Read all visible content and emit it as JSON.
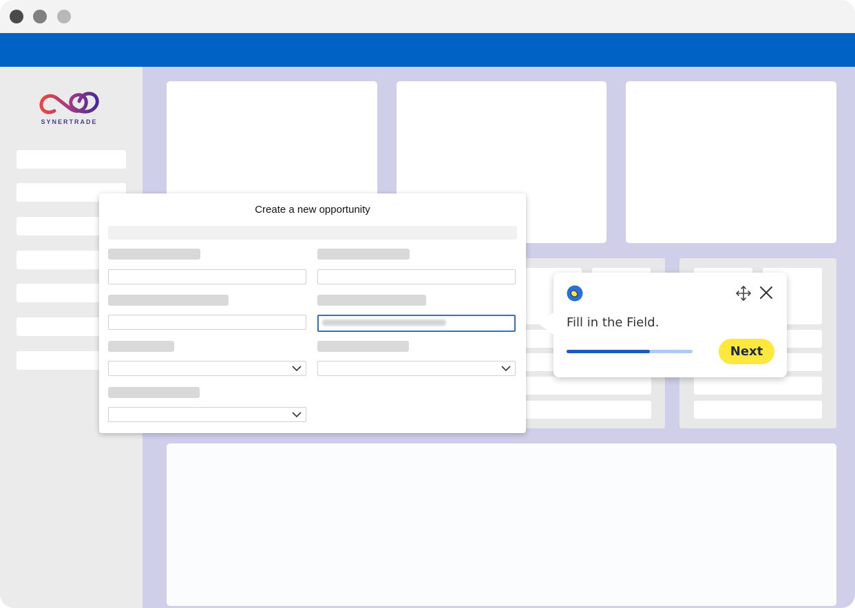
{
  "window": {
    "traffic_lights": [
      {
        "name": "close",
        "color": "#4a4a4a"
      },
      {
        "name": "minimize",
        "color": "#808080"
      },
      {
        "name": "maximize",
        "color": "#b8b8b8"
      }
    ],
    "topbar_color": "#0062c4"
  },
  "brand": {
    "name": "SYNERTRADE",
    "logo_icon": "infinity-loop-logo-icon"
  },
  "modal": {
    "title": "Create a new opportunity"
  },
  "tooltip": {
    "text": "Fill in the Field.",
    "next_label": "Next",
    "progress": 0.66,
    "badge_icon": "lemon-badge-icon",
    "move_icon": "move-arrows-icon",
    "close_icon": "close-icon",
    "accent_color": "#ffe83d"
  }
}
